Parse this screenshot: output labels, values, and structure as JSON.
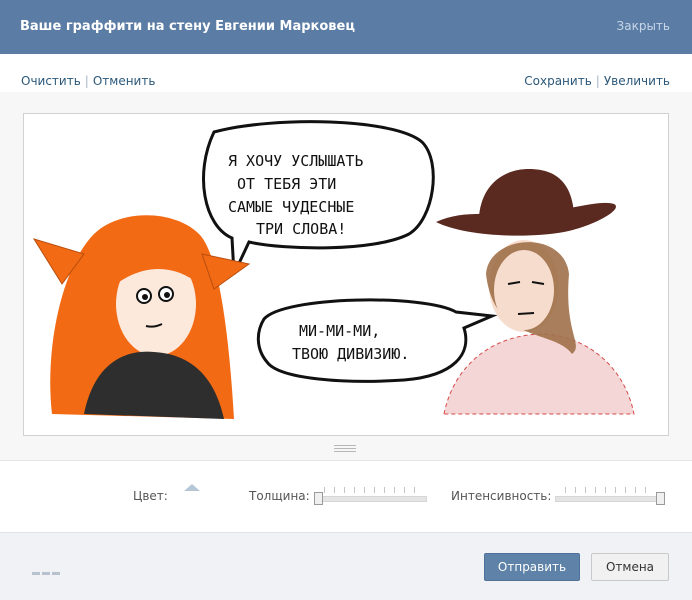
{
  "header": {
    "title": "Ваше граффити на стену Евгении Марковец",
    "close_label": "Закрыть"
  },
  "toolbar": {
    "clear_label": "Очистить",
    "undo_label": "Отменить",
    "save_label": "Сохранить",
    "zoom_label": "Увеличить"
  },
  "drawing": {
    "bubble1": [
      "Я ХОЧУ УСЛЫШАТЬ",
      "ОТ ТЕБЯ ЭТИ",
      "САМЫЕ ЧУДЕСНЫЕ",
      "ТРИ СЛОВА!"
    ],
    "bubble2": [
      "МИ-МИ-МИ,",
      "ТВОЮ ДИВИЗИЮ."
    ]
  },
  "settings": {
    "color_label": "Цвет:",
    "thickness_label": "Толщина:",
    "intensity_label": "Интенсивность:",
    "thickness_value": 0.0,
    "intensity_value": 1.0
  },
  "footer": {
    "send_label": "Отправить",
    "cancel_label": "Отмена"
  },
  "colors": {
    "header_bg": "#5b7ca4",
    "link": "#2b587a",
    "send_bg": "#5e82a8",
    "hair": "#f06a1a"
  }
}
